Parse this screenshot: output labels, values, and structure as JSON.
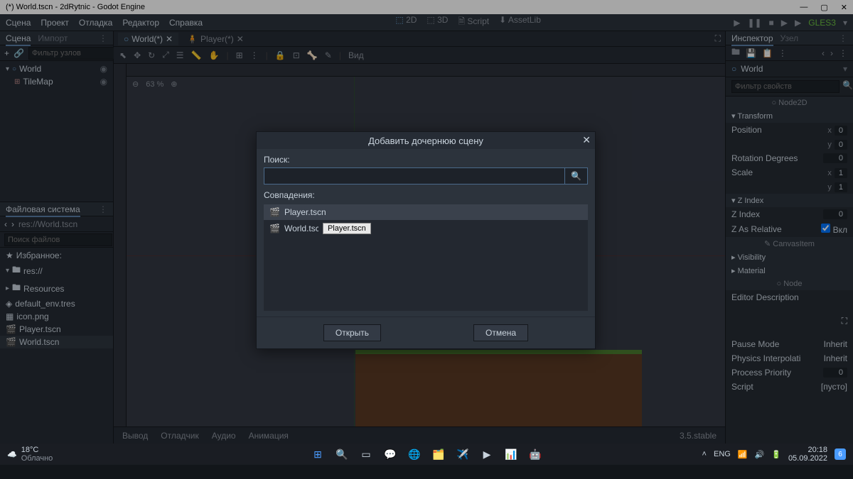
{
  "window": {
    "title": "(*) World.tscn - 2dRytnic - Godot Engine",
    "renderer": "GLES3"
  },
  "menu": {
    "scene": "Сцена",
    "project": "Проект",
    "debug": "Отладка",
    "editor": "Редактор",
    "help": "Справка",
    "mode_2d": "2D",
    "mode_3d": "3D",
    "mode_script": "Script",
    "mode_assetlib": "AssetLib"
  },
  "panels": {
    "scene": "Сцена",
    "import": "Импорт",
    "inspector": "Инспектор",
    "node": "Узел",
    "filesystem": "Файловая система"
  },
  "scene_tree": {
    "filter_placeholder": "Фильтр узлов",
    "root": "World",
    "child": "TileMap"
  },
  "fs": {
    "path": "res://World.tscn",
    "search_placeholder": "Поиск файлов",
    "favorites": "Избранное:",
    "root": "res://",
    "items": [
      "Resources",
      "default_env.tres",
      "icon.png",
      "Player.tscn",
      "World.tscn"
    ]
  },
  "scene_tabs": {
    "world": "World(*)",
    "player": "Player(*)"
  },
  "viewport": {
    "zoom": "63 %",
    "view_label": "Вид"
  },
  "bottom": {
    "output": "Вывод",
    "debugger": "Отладчик",
    "audio": "Аудио",
    "animation": "Анимация",
    "version": "3.5.stable"
  },
  "inspector": {
    "object": "World",
    "filter_placeholder": "Фильтр свойств",
    "node2d": "Node2D",
    "transform": "Transform",
    "position": "Position",
    "pos_x": "0",
    "pos_y": "0",
    "rotation": "Rotation Degrees",
    "rot_val": "0",
    "scale": "Scale",
    "scale_x": "1",
    "scale_y": "1",
    "zindex_section": "Z Index",
    "zindex": "Z Index",
    "zindex_val": "0",
    "zrelative": "Z As Relative",
    "zrelative_val": "Вкл",
    "canvasitem": "CanvasItem",
    "visibility": "Visibility",
    "material": "Material",
    "node_section": "Node",
    "editor_desc": "Editor Description",
    "pause_mode": "Pause Mode",
    "pause_val": "Inherit",
    "physics_interp": "Physics Interpolati",
    "physics_val": "Inherit",
    "process_priority": "Process Priority",
    "process_val": "0",
    "script": "Script",
    "script_val": "[пусто]"
  },
  "dialog": {
    "title": "Добавить дочернюю сцену",
    "search_label": "Поиск:",
    "matches_label": "Совпадения:",
    "match1": "Player.tscn",
    "match2": "World.tscn",
    "tooltip": "Player.tscn",
    "open": "Открыть",
    "cancel": "Отмена"
  },
  "taskbar": {
    "temp": "18°C",
    "weather": "Облачно",
    "lang": "ENG",
    "time": "20:18",
    "date": "05.09.2022",
    "notif": "6"
  }
}
